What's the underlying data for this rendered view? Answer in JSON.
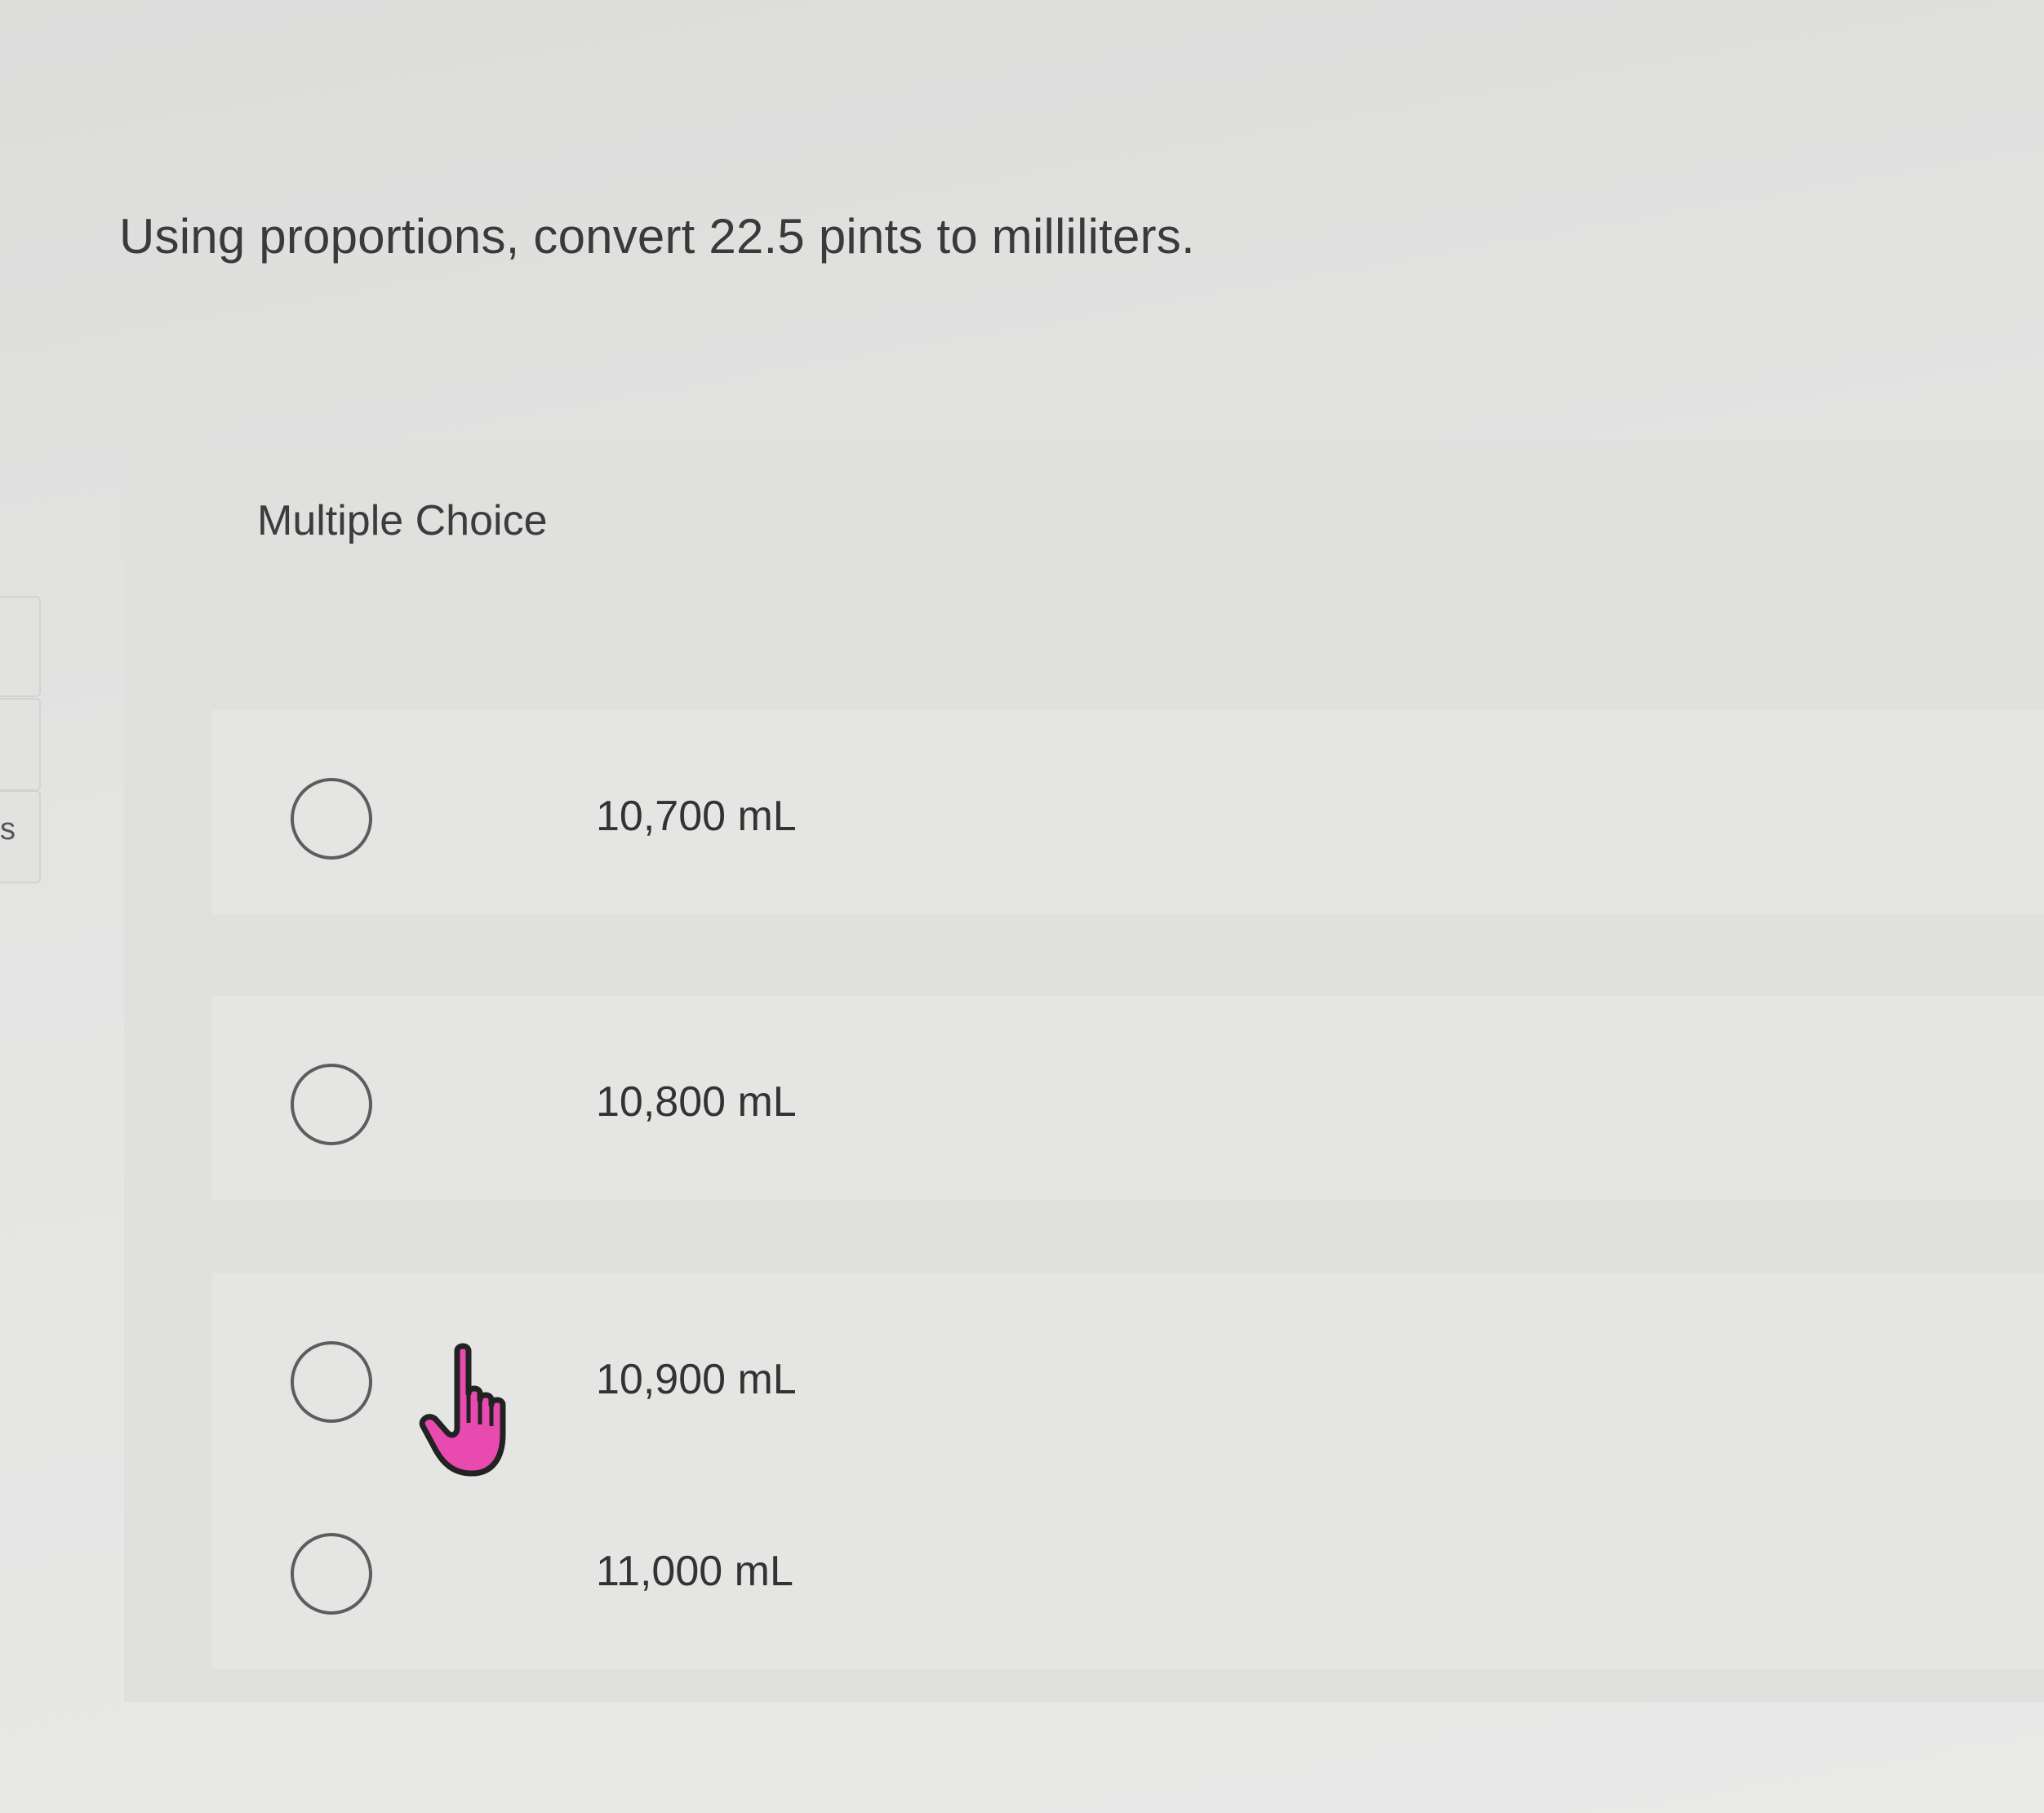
{
  "left_edge": {
    "letter": "s"
  },
  "question": {
    "text": "Using proportions, convert 22.5 pints to milliliters."
  },
  "multiple_choice": {
    "label": "Multiple Choice",
    "options": [
      {
        "label": "10,700 mL",
        "selected": false
      },
      {
        "label": "10,800 mL",
        "selected": false
      },
      {
        "label": "10,900 mL",
        "selected": false
      },
      {
        "label": "11,000 mL",
        "selected": false
      }
    ]
  },
  "colors": {
    "cursor_fill": "#e84ab0",
    "cursor_outline": "#222222",
    "radio_border": "#5d5d5d"
  },
  "icons": {
    "cursor": "pointer-hand-icon"
  }
}
